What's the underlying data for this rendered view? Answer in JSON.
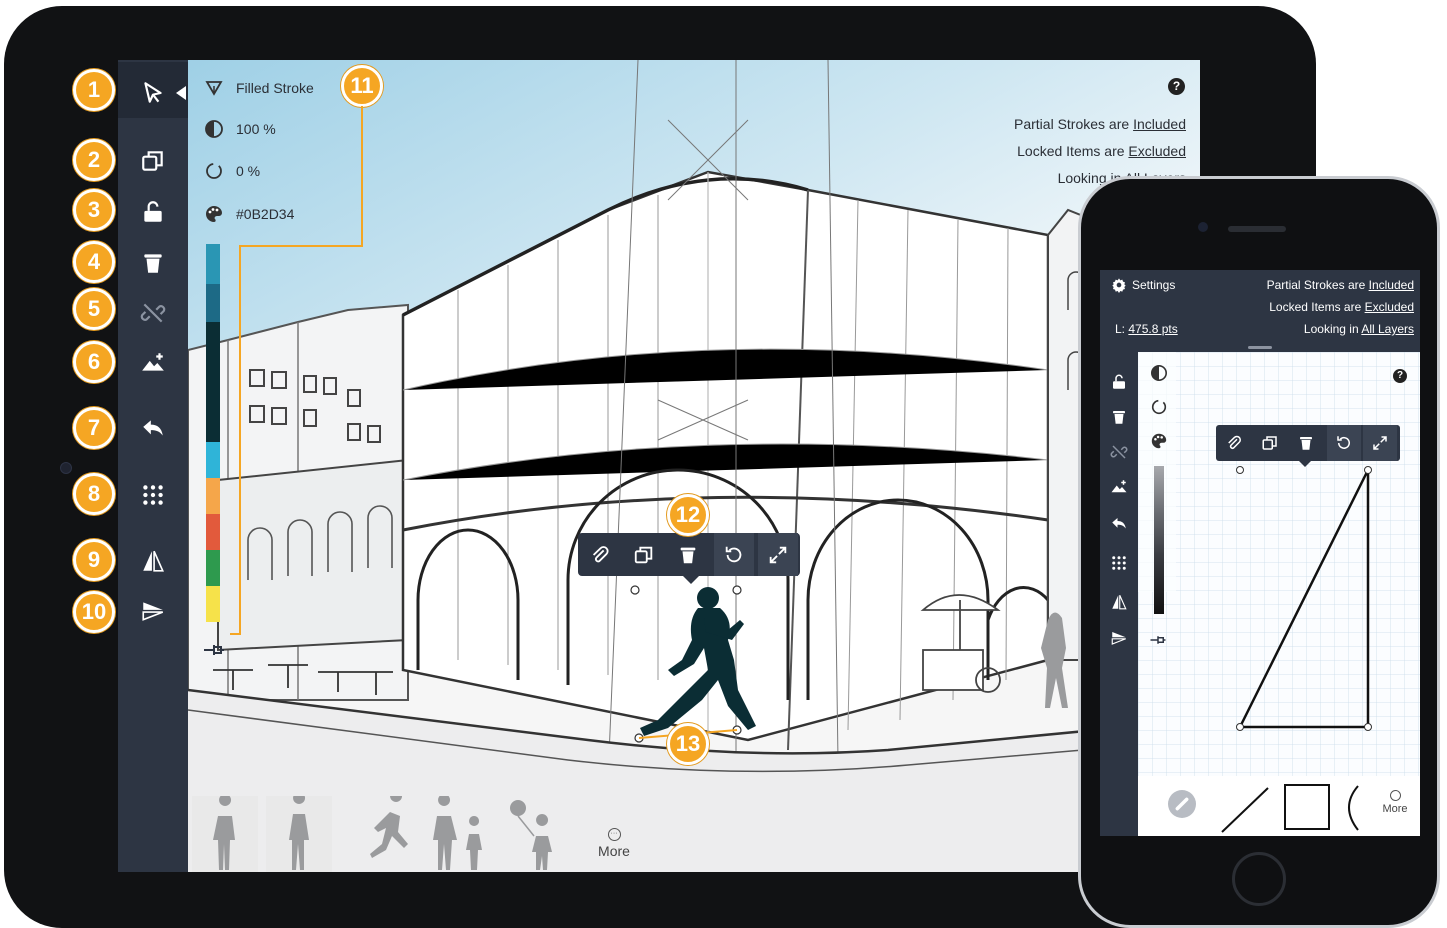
{
  "ipad": {
    "info_panel": {
      "stroke_type": "Filled Stroke",
      "opacity": "100 %",
      "smoothing": "0 %",
      "color_hex": "#0B2D34"
    },
    "settings_status": {
      "partial_prefix": "Partial Strokes are ",
      "partial_value": "Included",
      "locked_prefix": "Locked Items are ",
      "locked_value": "Excluded",
      "looking_prefix": "Looking in ",
      "looking_value": "All Layers"
    },
    "help_label": "?",
    "more_label": "More",
    "toolbar_icons": [
      "select-icon",
      "duplicate-icon",
      "unlock-icon",
      "trash-icon",
      "unlink-icon",
      "fill-layer-icon",
      "undo-icon",
      "grid-icon",
      "flip-horizontal-icon",
      "flip-vertical-icon"
    ],
    "popup_icons": [
      "paperclip-icon",
      "duplicate-icon",
      "trash-icon",
      "rotate-icon",
      "expand-icon"
    ],
    "swatch_colors": [
      "#2a96b4",
      "#1d6a86",
      "#0b2d34",
      "#0b2d34",
      "#2fb4d8",
      "#f5a64a",
      "#e25a3c",
      "#2e9a4e",
      "#f6e24a"
    ],
    "callouts": [
      "1",
      "2",
      "3",
      "4",
      "5",
      "6",
      "7",
      "8",
      "9",
      "10",
      "11",
      "12",
      "13"
    ]
  },
  "iphone": {
    "settings_label": "Settings",
    "length_prefix": "L: ",
    "length_value": "475.8 pts",
    "partial_prefix": "Partial Strokes are ",
    "partial_value": "Included",
    "locked_prefix": "Locked Items are ",
    "locked_value": "Excluded",
    "looking_prefix": "Looking in ",
    "looking_value": "All Layers",
    "help_label": "?",
    "more_label": "More"
  },
  "colors": {
    "toolbar": "#2d3543",
    "accent_orange": "#f5a623",
    "sky": "#b9dcec"
  }
}
